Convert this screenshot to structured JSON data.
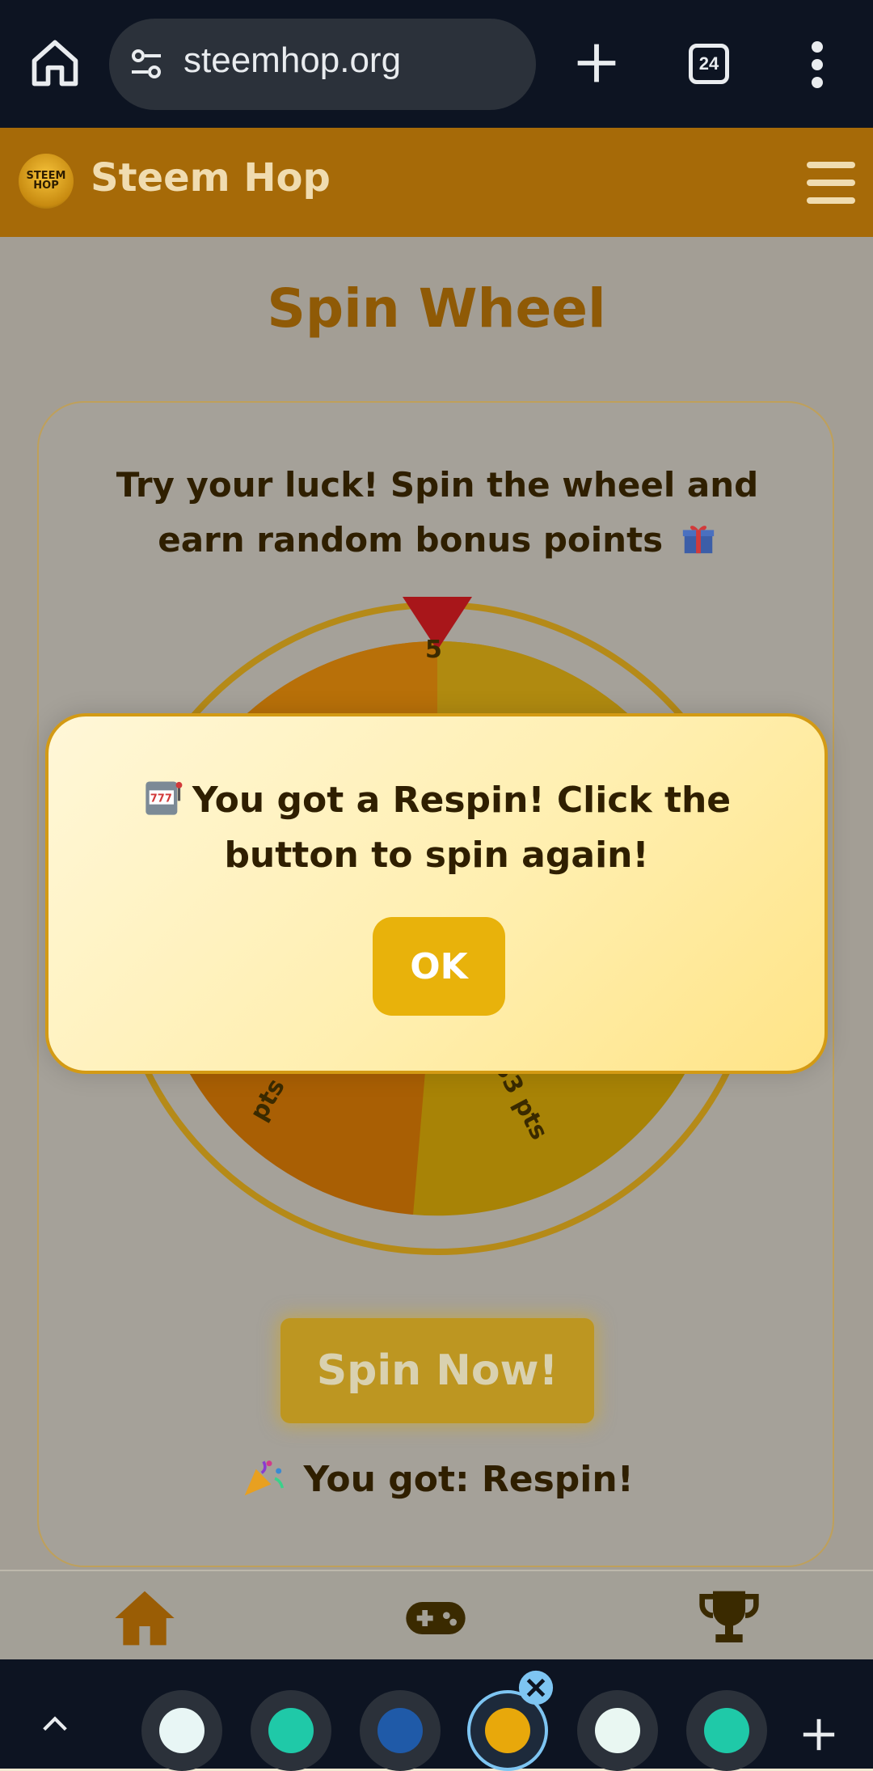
{
  "browser": {
    "url": "steemhop.org",
    "tab_count": "24"
  },
  "site": {
    "title": "Steem Hop",
    "logo_text": "STEEM\nHOP"
  },
  "page": {
    "title": "Spin Wheel",
    "intro": "Try your luck! Spin the wheel and earn random bonus points",
    "spin_label": "Spin Now!",
    "result": "You got: Respin!",
    "wheel_labels": [
      "5",
      "pts",
      "33 pts"
    ]
  },
  "modal": {
    "message_prefix": "You got a ",
    "message_bold": "Respin!",
    "message_suffix": " Click the button to spin again!",
    "ok_label": "OK"
  },
  "nav": {
    "items": [
      "home-icon",
      "gamepad-icon",
      "trophy-icon"
    ]
  },
  "colors": {
    "accent": "#a66a08",
    "gold": "#e8b20b",
    "browser_bg": "#0d1422"
  }
}
